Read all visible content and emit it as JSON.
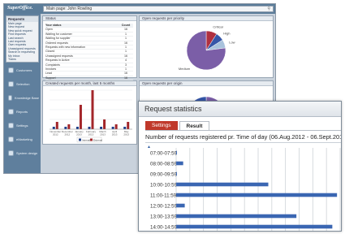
{
  "background": {
    "logo": "SuperOffice.",
    "topbar_title": "Main page: John Rowling",
    "search_icon": "search-icon",
    "sidebar": {
      "panel_title": "Requests",
      "items": [
        "Main page",
        "New request",
        "New quick request",
        "Find requests",
        "Last search",
        "Last requests",
        "Own requests",
        "Unassigned requests",
        "Search in requesting",
        "My inbox",
        "Trains"
      ],
      "nav": [
        {
          "label": "Customers",
          "icon": "customers-icon"
        },
        {
          "label": "Selection",
          "icon": "selection-icon"
        },
        {
          "label": "Knowledge Base",
          "icon": "knowledge-icon"
        },
        {
          "label": "Reports",
          "icon": "reports-icon"
        },
        {
          "label": "Settings",
          "icon": "settings-icon"
        },
        {
          "label": "eMarketing",
          "icon": "emarketing-icon"
        },
        {
          "label": "System design",
          "icon": "system-icon"
        }
      ]
    },
    "status_panel": {
      "title": "Status",
      "headers": [
        "Your status",
        "Count"
      ],
      "rows": [
        [
          "Open",
          "16"
        ],
        [
          "Waiting for customer",
          "1"
        ],
        [
          "Waiting for supplier",
          "1"
        ],
        [
          "Ordered requests",
          "16"
        ],
        [
          "Requests with new information",
          "1"
        ],
        [
          "Closed",
          "1"
        ],
        [
          "Unassigned requests",
          "16"
        ],
        [
          "Requests in Active",
          "4"
        ],
        [
          "Complaints",
          "3"
        ],
        [
          "Invoices",
          "1"
        ],
        [
          "Lead",
          "16"
        ],
        [
          "Support",
          "16"
        ]
      ]
    },
    "priority_panel": {
      "title": "Open requests per priority",
      "labels": [
        "Critical",
        "High",
        "Low",
        "Medium"
      ],
      "values": [
        9,
        7,
        7,
        77
      ],
      "colors": [
        "#b03040",
        "#3556a8",
        "#a8c2dc",
        "#7b5ea7"
      ]
    },
    "created_panel": {
      "title": "Created requests per month, last 5 months",
      "months": [
        "November 2012",
        "December 2012",
        "January 2013",
        "February 2013",
        "March 2013",
        "April 2013",
        "May 2013"
      ],
      "internal": [
        1,
        1,
        1,
        1,
        1,
        1,
        1
      ],
      "external": [
        3,
        2,
        10,
        16,
        4,
        2,
        3
      ],
      "legend": [
        "Internal",
        "External"
      ],
      "colors": [
        "#1f3f8a",
        "#a3262a"
      ]
    },
    "origin_panel": {
      "title": "Open requests per origin",
      "labels": [
        "Customer Centre",
        "Unknown",
        "Email"
      ],
      "values": [
        55,
        15,
        30
      ],
      "colors": [
        "#7b5ea7",
        "#b03040",
        "#3556a8"
      ]
    }
  },
  "dialog": {
    "title": "Request statistics",
    "tabs": {
      "settings": "Settings",
      "result": "Result"
    },
    "heading": "Number of requests registered pr. Time of day (06.Aug.2012 - 06.Sept.2013)",
    "marker": "▲",
    "chart_data": {
      "type": "bar",
      "orientation": "horizontal",
      "categories": [
        "07:00-07:59",
        "08:00-08:59",
        "09:00-09:59",
        "10:00-10:59",
        "11:00-11:59",
        "12:00-12:59",
        "13:00-13:59",
        "14:00-14:59"
      ],
      "values": [
        1,
        9,
        1,
        118,
        206,
        11,
        154,
        200
      ],
      "xlim": [
        0,
        210
      ],
      "grid": true,
      "bar_color": "#3a66b2"
    }
  }
}
